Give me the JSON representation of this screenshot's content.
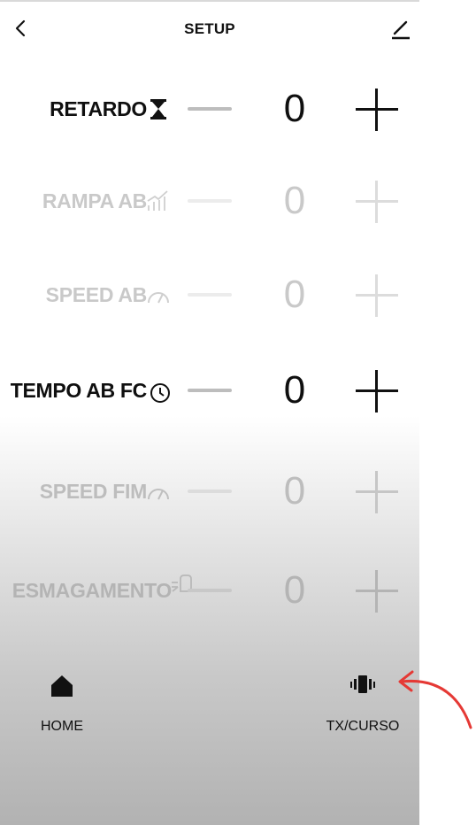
{
  "header": {
    "title": "SETUP",
    "back_icon": "chevron-left-icon",
    "edit_icon": "pencil-icon"
  },
  "params": [
    {
      "label": "RETARDO",
      "icon": "hourglass-icon",
      "value": "0",
      "state": "active"
    },
    {
      "label": "RAMPA AB",
      "icon": "ramp-chart-icon",
      "value": "0",
      "state": "disabled"
    },
    {
      "label": "SPEED AB",
      "icon": "speedometer-icon",
      "value": "0",
      "state": "disabled"
    },
    {
      "label": "TEMPO AB FC",
      "icon": "clock-icon",
      "value": "0",
      "state": "active"
    },
    {
      "label": "SPEED FIM",
      "icon": "speedometer-icon",
      "value": "0",
      "state": "disabled"
    },
    {
      "label": "ESMAGAMENTO",
      "icon": "crush-sensor-icon",
      "value": "0",
      "state": "disabled"
    }
  ],
  "nav": {
    "home": {
      "label": "HOME",
      "icon": "home-icon"
    },
    "tx": {
      "label": "TX/CURSO",
      "icon": "vibration-icon"
    }
  },
  "annotation": {
    "icon": "curved-arrow-icon",
    "color": "#e53935"
  },
  "colors": {
    "active_text": "#0f0f0f",
    "disabled_text": "#c9c9c9",
    "annotation": "#e53935"
  }
}
